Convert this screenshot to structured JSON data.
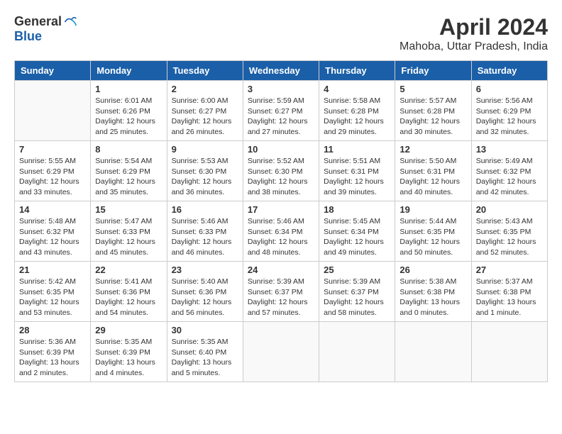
{
  "header": {
    "logo_general": "General",
    "logo_blue": "Blue",
    "title": "April 2024",
    "subtitle": "Mahoba, Uttar Pradesh, India"
  },
  "days_of_week": [
    "Sunday",
    "Monday",
    "Tuesday",
    "Wednesday",
    "Thursday",
    "Friday",
    "Saturday"
  ],
  "weeks": [
    [
      {
        "day": "",
        "info": ""
      },
      {
        "day": "1",
        "info": "Sunrise: 6:01 AM\nSunset: 6:26 PM\nDaylight: 12 hours\nand 25 minutes."
      },
      {
        "day": "2",
        "info": "Sunrise: 6:00 AM\nSunset: 6:27 PM\nDaylight: 12 hours\nand 26 minutes."
      },
      {
        "day": "3",
        "info": "Sunrise: 5:59 AM\nSunset: 6:27 PM\nDaylight: 12 hours\nand 27 minutes."
      },
      {
        "day": "4",
        "info": "Sunrise: 5:58 AM\nSunset: 6:28 PM\nDaylight: 12 hours\nand 29 minutes."
      },
      {
        "day": "5",
        "info": "Sunrise: 5:57 AM\nSunset: 6:28 PM\nDaylight: 12 hours\nand 30 minutes."
      },
      {
        "day": "6",
        "info": "Sunrise: 5:56 AM\nSunset: 6:29 PM\nDaylight: 12 hours\nand 32 minutes."
      }
    ],
    [
      {
        "day": "7",
        "info": "Sunrise: 5:55 AM\nSunset: 6:29 PM\nDaylight: 12 hours\nand 33 minutes."
      },
      {
        "day": "8",
        "info": "Sunrise: 5:54 AM\nSunset: 6:29 PM\nDaylight: 12 hours\nand 35 minutes."
      },
      {
        "day": "9",
        "info": "Sunrise: 5:53 AM\nSunset: 6:30 PM\nDaylight: 12 hours\nand 36 minutes."
      },
      {
        "day": "10",
        "info": "Sunrise: 5:52 AM\nSunset: 6:30 PM\nDaylight: 12 hours\nand 38 minutes."
      },
      {
        "day": "11",
        "info": "Sunrise: 5:51 AM\nSunset: 6:31 PM\nDaylight: 12 hours\nand 39 minutes."
      },
      {
        "day": "12",
        "info": "Sunrise: 5:50 AM\nSunset: 6:31 PM\nDaylight: 12 hours\nand 40 minutes."
      },
      {
        "day": "13",
        "info": "Sunrise: 5:49 AM\nSunset: 6:32 PM\nDaylight: 12 hours\nand 42 minutes."
      }
    ],
    [
      {
        "day": "14",
        "info": "Sunrise: 5:48 AM\nSunset: 6:32 PM\nDaylight: 12 hours\nand 43 minutes."
      },
      {
        "day": "15",
        "info": "Sunrise: 5:47 AM\nSunset: 6:33 PM\nDaylight: 12 hours\nand 45 minutes."
      },
      {
        "day": "16",
        "info": "Sunrise: 5:46 AM\nSunset: 6:33 PM\nDaylight: 12 hours\nand 46 minutes."
      },
      {
        "day": "17",
        "info": "Sunrise: 5:46 AM\nSunset: 6:34 PM\nDaylight: 12 hours\nand 48 minutes."
      },
      {
        "day": "18",
        "info": "Sunrise: 5:45 AM\nSunset: 6:34 PM\nDaylight: 12 hours\nand 49 minutes."
      },
      {
        "day": "19",
        "info": "Sunrise: 5:44 AM\nSunset: 6:35 PM\nDaylight: 12 hours\nand 50 minutes."
      },
      {
        "day": "20",
        "info": "Sunrise: 5:43 AM\nSunset: 6:35 PM\nDaylight: 12 hours\nand 52 minutes."
      }
    ],
    [
      {
        "day": "21",
        "info": "Sunrise: 5:42 AM\nSunset: 6:35 PM\nDaylight: 12 hours\nand 53 minutes."
      },
      {
        "day": "22",
        "info": "Sunrise: 5:41 AM\nSunset: 6:36 PM\nDaylight: 12 hours\nand 54 minutes."
      },
      {
        "day": "23",
        "info": "Sunrise: 5:40 AM\nSunset: 6:36 PM\nDaylight: 12 hours\nand 56 minutes."
      },
      {
        "day": "24",
        "info": "Sunrise: 5:39 AM\nSunset: 6:37 PM\nDaylight: 12 hours\nand 57 minutes."
      },
      {
        "day": "25",
        "info": "Sunrise: 5:39 AM\nSunset: 6:37 PM\nDaylight: 12 hours\nand 58 minutes."
      },
      {
        "day": "26",
        "info": "Sunrise: 5:38 AM\nSunset: 6:38 PM\nDaylight: 13 hours\nand 0 minutes."
      },
      {
        "day": "27",
        "info": "Sunrise: 5:37 AM\nSunset: 6:38 PM\nDaylight: 13 hours\nand 1 minute."
      }
    ],
    [
      {
        "day": "28",
        "info": "Sunrise: 5:36 AM\nSunset: 6:39 PM\nDaylight: 13 hours\nand 2 minutes."
      },
      {
        "day": "29",
        "info": "Sunrise: 5:35 AM\nSunset: 6:39 PM\nDaylight: 13 hours\nand 4 minutes."
      },
      {
        "day": "30",
        "info": "Sunrise: 5:35 AM\nSunset: 6:40 PM\nDaylight: 13 hours\nand 5 minutes."
      },
      {
        "day": "",
        "info": ""
      },
      {
        "day": "",
        "info": ""
      },
      {
        "day": "",
        "info": ""
      },
      {
        "day": "",
        "info": ""
      }
    ]
  ]
}
